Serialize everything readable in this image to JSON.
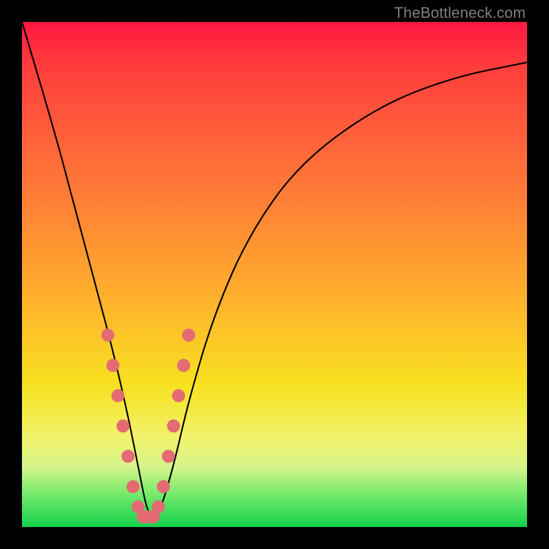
{
  "watermark": "TheBottleneck.com",
  "chart_data": {
    "type": "line",
    "title": "",
    "xlabel": "",
    "ylabel": "",
    "xlim": [
      0,
      100
    ],
    "ylim": [
      0,
      100
    ],
    "series": [
      {
        "name": "bottleneck-curve",
        "x": [
          0,
          6,
          10,
          14,
          18,
          21,
          23,
          25,
          27,
          30,
          33,
          38,
          45,
          55,
          70,
          85,
          100
        ],
        "values": [
          100,
          80,
          65,
          50,
          35,
          22,
          12,
          2,
          2,
          12,
          25,
          42,
          58,
          72,
          83,
          89,
          92
        ]
      }
    ],
    "markers": {
      "name": "highlight-dots",
      "color": "#e46a74",
      "x": [
        17,
        18,
        19,
        20,
        21,
        22,
        23,
        24,
        25,
        26,
        27,
        28,
        29,
        30,
        31,
        32,
        33
      ],
      "values": [
        38,
        32,
        26,
        20,
        14,
        8,
        4,
        2,
        2,
        2,
        4,
        8,
        14,
        20,
        26,
        32,
        38
      ]
    },
    "background_gradient": {
      "top": "#ff1744",
      "mid": "#f7e221",
      "bottom": "#14d14a"
    }
  }
}
